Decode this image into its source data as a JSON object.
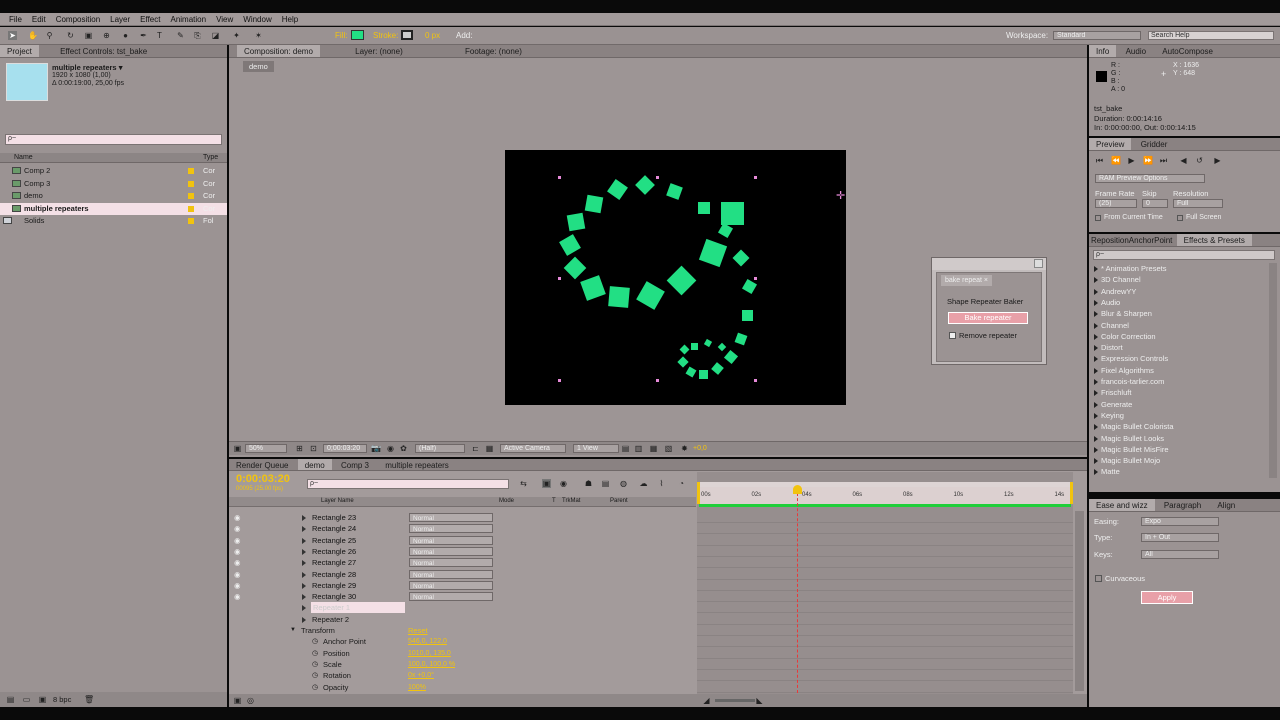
{
  "menu": [
    "File",
    "Edit",
    "Composition",
    "Layer",
    "Effect",
    "Animation",
    "View",
    "Window",
    "Help"
  ],
  "toolbar": {
    "fill_label": "Fill:",
    "stroke_label": "Stroke:",
    "stroke_px": "0 px",
    "add_label": "Add:",
    "workspace_label": "Workspace:",
    "workspace_value": "Standard",
    "search_placeholder": "Search Help"
  },
  "project": {
    "tab_project": "Project",
    "tab_effect_controls": "Effect Controls: tst_bake",
    "thumb_name": "multiple repeaters ▾",
    "thumb_dims": "1920 x 1080 (1,00)",
    "thumb_dur": "Δ 0:00:19:00, 25,00 fps",
    "search_placeholder": "ρ~",
    "col_name": "Name",
    "col_type": "Type",
    "items": [
      {
        "name": "Comp 2",
        "type": "Cor"
      },
      {
        "name": "Comp 3",
        "type": "Cor"
      },
      {
        "name": "demo",
        "type": "Cor"
      },
      {
        "name": "multiple repeaters",
        "type": "Cor"
      },
      {
        "name": "Solids",
        "type": "Fol"
      }
    ],
    "bpc": "8 bpc"
  },
  "comp": {
    "tab_comp": "Composition: demo",
    "tab_layer": "Layer: (none)",
    "tab_footage": "Footage: (none)",
    "crumb": "demo",
    "zoom": "50%",
    "timecode": "0;00:03:20",
    "quality": "(Half)",
    "camera": "Active Camera",
    "views": "1 View",
    "exposure": "+0,0"
  },
  "dialog": {
    "title": "bake repeat",
    "heading": "Shape Repeater Baker",
    "bake_button": "Bake repeater",
    "remove_label": "Remove repeater"
  },
  "info": {
    "tab_info": "Info",
    "tab_audio": "Audio",
    "tab_autocompose": "AutoCompose",
    "r": "R :",
    "g": "G :",
    "b": "B :",
    "a": "A : 0",
    "x": "X : 1636",
    "y": "Y : 648",
    "layer": "tst_bake",
    "duration": "Duration: 0:00:14:16",
    "inout": "In: 0:00:00:00, Out: 0:00:14:15"
  },
  "preview": {
    "tab_preview": "Preview",
    "tab_gridder": "Gridder",
    "ram": "RAM Preview Options",
    "fr_label": "Frame Rate",
    "skip_label": "Skip",
    "res_label": "Resolution",
    "fr_value": "(25)",
    "skip_value": "0",
    "res_value": "Full",
    "from_current": "From Current Time",
    "full_screen": "Full Screen"
  },
  "effects": {
    "tab_reposition": "RepositionAnchorPoint",
    "tab_effects": "Effects & Presets",
    "search_placeholder": "ρ~",
    "items": [
      "* Animation Presets",
      "3D Channel",
      "AndrewYY",
      "Audio",
      "Blur & Sharpen",
      "Channel",
      "Color Correction",
      "Distort",
      "Expression Controls",
      "Fixel Algorithms",
      "francois-tarlier.com",
      "Frischluft",
      "Generate",
      "Keying",
      "Magic Bullet Colorista",
      "Magic Bullet Looks",
      "Magic Bullet MisFire",
      "Magic Bullet Mojo",
      "Matte"
    ]
  },
  "ease": {
    "tab_ease": "Ease and wizz",
    "tab_paragraph": "Paragraph",
    "tab_align": "Align",
    "easing_label": "Easing:",
    "easing_value": "Expo",
    "type_label": "Type:",
    "type_value": "In + Out",
    "keys_label": "Keys:",
    "keys_value": "All",
    "curvaceous": "Curvaceous",
    "apply": "Apply"
  },
  "timeline": {
    "tabs": [
      "Render Queue",
      "demo",
      "Comp 3",
      "multiple repeaters"
    ],
    "timecode": "0:00:03:20",
    "frames": "00095 (25.00 fps)",
    "search_placeholder": "ρ~",
    "col_layer": "Layer Name",
    "col_mode": "Mode",
    "col_t": "T",
    "col_trkmat": "TrkMat",
    "col_parent": "Parent",
    "ruler": [
      "00s",
      "02s",
      "04s",
      "06s",
      "08s",
      "10s",
      "12s",
      "14s"
    ],
    "layers": [
      {
        "name": "Rectangle 23",
        "mode": "Normal"
      },
      {
        "name": "Rectangle 24",
        "mode": "Normal"
      },
      {
        "name": "Rectangle 25",
        "mode": "Normal"
      },
      {
        "name": "Rectangle 26",
        "mode": "Normal"
      },
      {
        "name": "Rectangle 27",
        "mode": "Normal"
      },
      {
        "name": "Rectangle 28",
        "mode": "Normal"
      },
      {
        "name": "Rectangle 29",
        "mode": "Normal"
      },
      {
        "name": "Rectangle 30",
        "mode": "Normal"
      }
    ],
    "repeater1": "Repeater 1",
    "repeater2": "Repeater 2",
    "transform": "Transform",
    "reset": "Reset",
    "props": [
      {
        "name": "Anchor Point",
        "value": "546,0, 122,0"
      },
      {
        "name": "Position",
        "value": "1010,0, 135,0"
      },
      {
        "name": "Scale",
        "value": "100,0, 100,0 %"
      },
      {
        "name": "Rotation",
        "value": "0x +0,0°"
      },
      {
        "name": "Opacity",
        "value": "100%"
      }
    ]
  },
  "colors": {
    "shape": "#22df84",
    "accent": "#f1c30f",
    "playhead": "#e8393a"
  }
}
